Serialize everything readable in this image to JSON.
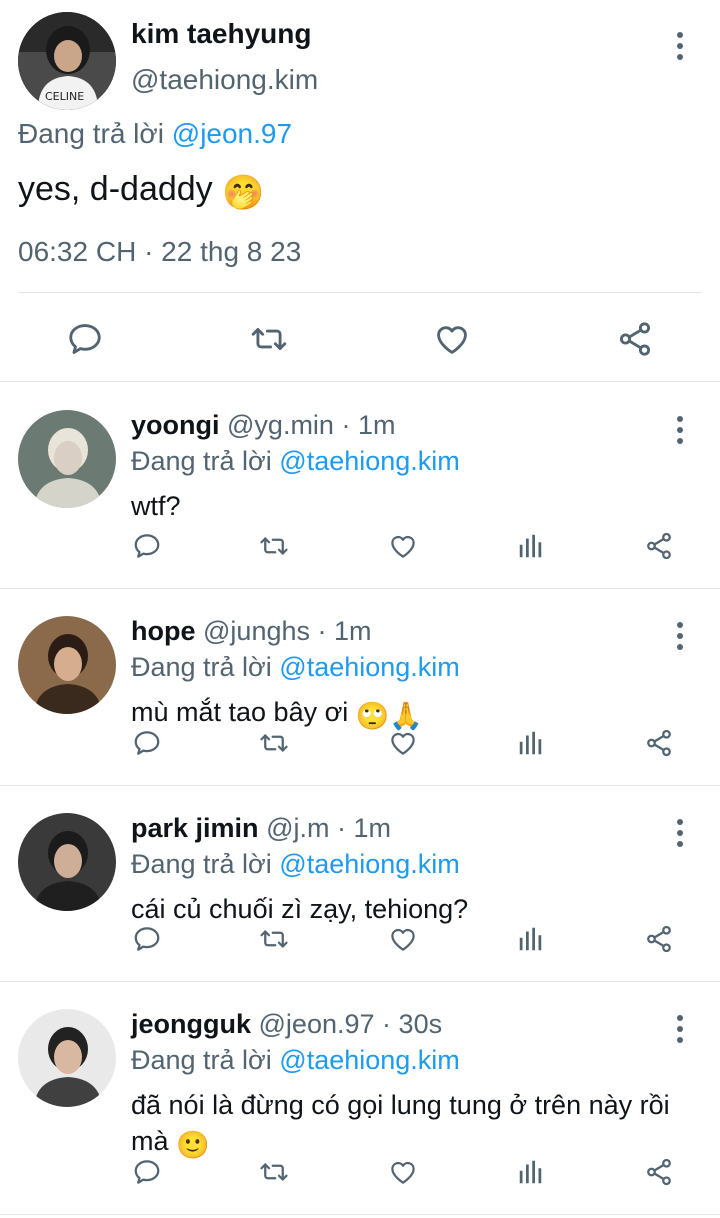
{
  "reply_prefix": "Đang trả lời",
  "main_tweet": {
    "name": "kim taehyung",
    "handle": "@taehiong.kim",
    "reply_to": "@jeon.97",
    "text": "yes, d-daddy",
    "text_emoji": "🤭",
    "timestamp": "06:32 CH · 22 thg 8 23",
    "actions": [
      "reply-icon",
      "retweet-icon",
      "like-icon",
      "share-icon"
    ],
    "avatar_text": "CELINE"
  },
  "replies": [
    {
      "name": "yoongi",
      "handle": "@yg.min",
      "time": "1m",
      "reply_to": "@taehiong.kim",
      "text": "wtf?",
      "emoji": ""
    },
    {
      "name": "hope",
      "handle": "@junghs",
      "time": "1m",
      "reply_to": "@taehiong.kim",
      "text": "mù mắt tao bây ơi",
      "emoji": "🙄🙏"
    },
    {
      "name": "park jimin",
      "handle": "@j.m",
      "time": "1m",
      "reply_to": "@taehiong.kim",
      "text": "cái củ chuối zì zạy, tehiong?",
      "emoji": ""
    },
    {
      "name": "jeongguk",
      "handle": "@jeon.97",
      "time": "30s",
      "reply_to": "@taehiong.kim",
      "text": "đã nói là đừng có gọi lung tung ở trên này rồi mà",
      "emoji": "🙂"
    }
  ],
  "colors": {
    "text": "#0f1419",
    "secondary": "#536471",
    "link": "#1d9bf0",
    "divider": "#e3e6e8"
  }
}
